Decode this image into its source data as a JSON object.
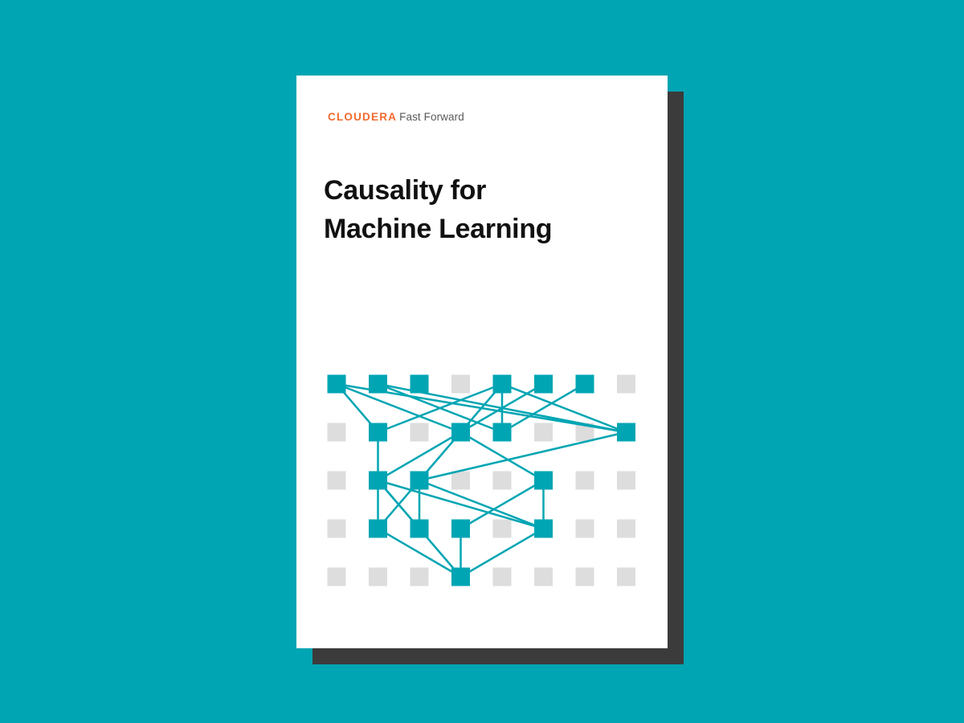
{
  "brand": {
    "name": "CLOUDERA",
    "sub": "Fast Forward"
  },
  "title": {
    "line1": "Causality for",
    "line2": "Machine Learning"
  },
  "colors": {
    "background": "#00a5b3",
    "shadow": "#3b3b3b",
    "cover": "#ffffff",
    "brand_accent": "#f26a2e",
    "node_active": "#00a5b3",
    "node_inactive": "#dddddd",
    "edge": "#00a5b3"
  },
  "graph": {
    "columns": 8,
    "rows": 5,
    "active_nodes": [
      [
        0,
        0
      ],
      [
        1,
        0
      ],
      [
        2,
        0
      ],
      [
        4,
        0
      ],
      [
        5,
        0
      ],
      [
        6,
        0
      ],
      [
        1,
        1
      ],
      [
        3,
        1
      ],
      [
        4,
        1
      ],
      [
        7,
        1
      ],
      [
        1,
        2
      ],
      [
        2,
        2
      ],
      [
        5,
        2
      ],
      [
        1,
        3
      ],
      [
        2,
        3
      ],
      [
        3,
        3
      ],
      [
        5,
        3
      ],
      [
        3,
        4
      ]
    ],
    "edges": [
      [
        [
          0,
          0
        ],
        [
          1,
          1
        ]
      ],
      [
        [
          0,
          0
        ],
        [
          3,
          1
        ]
      ],
      [
        [
          0,
          0
        ],
        [
          7,
          1
        ]
      ],
      [
        [
          1,
          0
        ],
        [
          4,
          1
        ]
      ],
      [
        [
          1,
          0
        ],
        [
          7,
          1
        ]
      ],
      [
        [
          4,
          0
        ],
        [
          1,
          1
        ]
      ],
      [
        [
          4,
          0
        ],
        [
          3,
          1
        ]
      ],
      [
        [
          4,
          0
        ],
        [
          4,
          1
        ]
      ],
      [
        [
          5,
          0
        ],
        [
          3,
          1
        ]
      ],
      [
        [
          6,
          0
        ],
        [
          4,
          1
        ]
      ],
      [
        [
          4,
          0
        ],
        [
          7,
          1
        ]
      ],
      [
        [
          1,
          1
        ],
        [
          1,
          2
        ]
      ],
      [
        [
          3,
          1
        ],
        [
          1,
          2
        ]
      ],
      [
        [
          3,
          1
        ],
        [
          2,
          2
        ]
      ],
      [
        [
          3,
          1
        ],
        [
          5,
          2
        ]
      ],
      [
        [
          7,
          1
        ],
        [
          2,
          2
        ]
      ],
      [
        [
          1,
          2
        ],
        [
          1,
          3
        ]
      ],
      [
        [
          1,
          2
        ],
        [
          2,
          3
        ]
      ],
      [
        [
          1,
          2
        ],
        [
          5,
          3
        ]
      ],
      [
        [
          2,
          2
        ],
        [
          1,
          3
        ]
      ],
      [
        [
          2,
          2
        ],
        [
          2,
          3
        ]
      ],
      [
        [
          2,
          2
        ],
        [
          5,
          3
        ]
      ],
      [
        [
          5,
          2
        ],
        [
          3,
          3
        ]
      ],
      [
        [
          5,
          2
        ],
        [
          5,
          3
        ]
      ],
      [
        [
          1,
          3
        ],
        [
          3,
          4
        ]
      ],
      [
        [
          3,
          3
        ],
        [
          3,
          4
        ]
      ],
      [
        [
          5,
          3
        ],
        [
          3,
          4
        ]
      ],
      [
        [
          1,
          2
        ],
        [
          3,
          4
        ]
      ]
    ]
  }
}
